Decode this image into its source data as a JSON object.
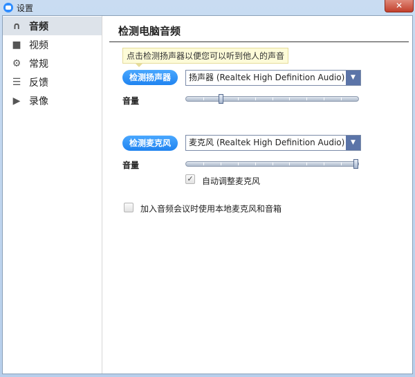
{
  "window": {
    "title": "设置",
    "close_icon": "close-icon"
  },
  "sidebar": {
    "items": [
      {
        "label": "音频",
        "icon": "headphones-icon",
        "selected": true
      },
      {
        "label": "视频",
        "icon": "video-camera-icon"
      },
      {
        "label": "常规",
        "icon": "gears-icon"
      },
      {
        "label": "反馈",
        "icon": "feedback-icon"
      },
      {
        "label": "录像",
        "icon": "recording-icon"
      }
    ]
  },
  "main": {
    "title": "检测电脑音频",
    "tooltip": "点击检测扬声器以便您可以听到他人的声音",
    "speaker": {
      "button": "检测扬声器",
      "device": "扬声器 (Realtek High Definition Audio)",
      "volume_label": "音量",
      "volume": 0.2
    },
    "mic": {
      "button": "检测麦克风",
      "device": "麦克风 (Realtek High Definition Audio)",
      "volume_label": "音量",
      "volume": 1.0,
      "auto_adjust": {
        "label": "自动调整麦克风",
        "checked": true
      }
    },
    "join_audio": {
      "label": "加入音频会议时使用本地麦克风和音箱",
      "checked": false
    }
  },
  "colors": {
    "accent": "#2d8cff",
    "selected_bg": "#dde3ea"
  }
}
